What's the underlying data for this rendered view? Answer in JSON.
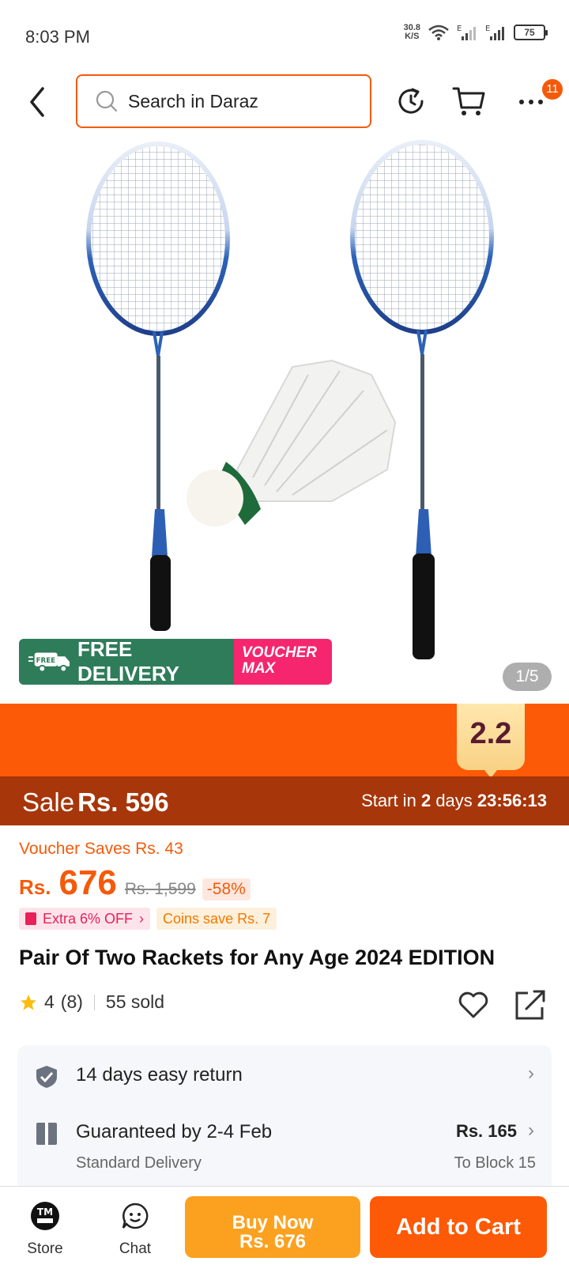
{
  "status_bar": {
    "time": "8:03 PM",
    "net_speed_value": "30.8",
    "net_speed_unit": "K/S",
    "battery": "75"
  },
  "header": {
    "search_placeholder": "Search in Daraz",
    "more_badge_count": "11"
  },
  "gallery": {
    "promo_free_delivery": "FREE DELIVERY",
    "promo_free_tag": "FREE",
    "promo_voucher_line1": "VOUCHER",
    "promo_voucher_line2": "MAX",
    "image_counter": "1/5"
  },
  "campaign": {
    "tag": "2.2",
    "sale_label": "Sale",
    "sale_price": "Rs. 596",
    "start_prefix": "Start in",
    "start_days": "2",
    "start_days_label": "days",
    "countdown": "23:56:13"
  },
  "pricing": {
    "voucher_saves": "Voucher Saves Rs. 43",
    "currency": "Rs.",
    "price": "676",
    "original_price": "Rs. 1,599",
    "discount": "-58%",
    "extra_off": "Extra 6% OFF",
    "coins_save": "Coins save Rs. 7"
  },
  "product": {
    "title": "Pair Of Two Rackets for Any Age 2024 EDITION",
    "rating": "4",
    "rating_count": "(8)",
    "sold": "55 sold"
  },
  "services": {
    "return_policy": "14 days easy return",
    "delivery_guarantee": "Guaranteed by 2-4 Feb",
    "delivery_type": "Standard Delivery",
    "delivery_fee": "Rs. 165",
    "delivery_location": "To Block 15"
  },
  "bottom_bar": {
    "store_label": "Store",
    "chat_label": "Chat",
    "buy_now_label": "Buy Now",
    "buy_now_price": "Rs. 676",
    "add_to_cart_label": "Add to Cart"
  },
  "colors": {
    "brand_orange": "#f55a0a",
    "sale_bar": "#a7360a",
    "buy_now": "#fca11f",
    "free_delivery_green": "#2f7c5a",
    "voucher_pink": "#f5266e"
  }
}
